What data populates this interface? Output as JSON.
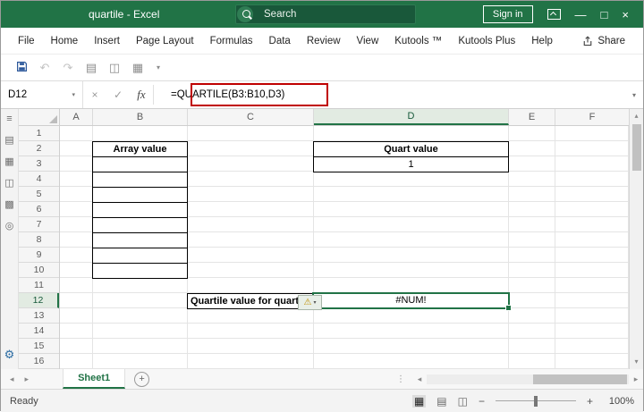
{
  "colors": {
    "excel_green": "#217346",
    "annotation_red": "#c00000",
    "selection_green": "#217346"
  },
  "title_bar": {
    "title": "quartile - Excel",
    "search_label": "Search",
    "sign_in_label": "Sign in"
  },
  "menu_bar": {
    "tabs": [
      "File",
      "Home",
      "Insert",
      "Page Layout",
      "Formulas",
      "Data",
      "Review",
      "View",
      "Kutools ™",
      "Kutools Plus",
      "Help"
    ],
    "share_label": "Share"
  },
  "formula_bar": {
    "name_box_value": "D12",
    "cancel_glyph": "×",
    "enter_glyph": "✓",
    "fx_label": "fx",
    "formula": "=QUARTILE(B3:B10,D3)"
  },
  "sheet": {
    "column_headers": [
      "A",
      "B",
      "C",
      "D",
      "E",
      "F"
    ],
    "row_headers": [
      "1",
      "2",
      "3",
      "4",
      "5",
      "6",
      "7",
      "8",
      "9",
      "10",
      "11",
      "12",
      "13",
      "14",
      "15",
      "16"
    ],
    "selected_cell_ref": "D12",
    "array_table": {
      "header": "Array value"
    },
    "quart_table": {
      "header": "Quart value",
      "value": "1"
    },
    "label_cell": "Quartile value for quart",
    "result_cell": "#NUM!"
  },
  "tabs_bar": {
    "sheet_name": "Sheet1",
    "add_glyph": "+"
  },
  "status_bar": {
    "status": "Ready",
    "zoom_level": "100%"
  },
  "icons": {
    "menu": "≡",
    "strip": [
      "▤",
      "▦",
      "◫",
      "▩",
      "◎"
    ],
    "gear": "⚙",
    "undo": "↶",
    "redo": "↷",
    "qat1": "▤",
    "qat2": "◫",
    "qat3": "▦",
    "dropdown": "▾",
    "minimize": "—",
    "restore": "□",
    "close": "×",
    "scroll_up": "▴",
    "scroll_down": "▾",
    "scroll_left": "◂",
    "scroll_right": "▸",
    "warning": "⚠",
    "view_normal": "▦",
    "view_layout": "▤",
    "view_break": "◫",
    "zoom_out": "−",
    "zoom_in": "+",
    "divider_dots": "⋮",
    "name_dd": "▾",
    "fb_chevron": "▾"
  }
}
